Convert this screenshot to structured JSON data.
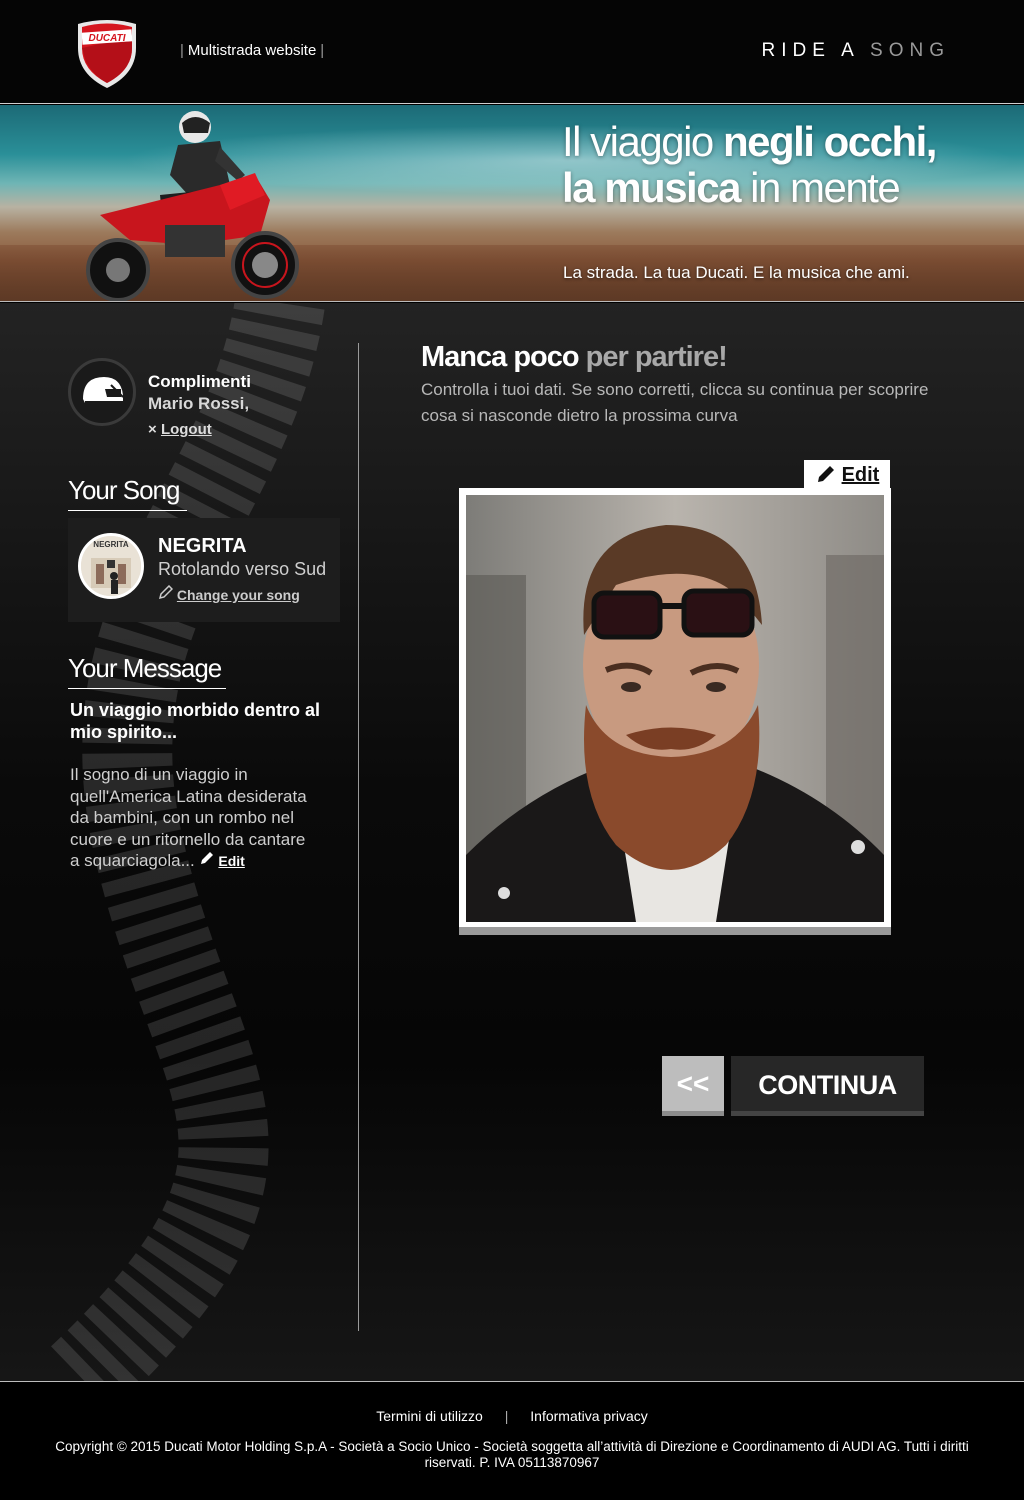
{
  "header": {
    "logo_text": "DUCATI",
    "site_link": "Multistrada website",
    "pipe": "|",
    "brand_ride": "RIDE A",
    "brand_song": "SONG"
  },
  "hero": {
    "title_light_1": "Il viaggio ",
    "title_bold_1": "negli occhi,",
    "title_bold_2": "la musica",
    "title_light_2": " in mente",
    "subtitle": "La strada. La tua Ducati. E la musica che ami."
  },
  "user": {
    "greeting": "Complimenti",
    "name": "Mario Rossi,",
    "logout_icon": "×",
    "logout_label": "Logout"
  },
  "song": {
    "section_title": "Your Song",
    "cover_text": "NEGRITA",
    "artist": "NEGRITA",
    "track": "Rotolando verso Sud",
    "change_label": "Change your song"
  },
  "message": {
    "section_title": "Your Message",
    "headline": "Un viaggio morbido dentro al mio spirito...",
    "body": "Il sogno di un viaggio in quell'America Latina desiderata da bambini, con un rombo nel cuore e un ritornello da cantare a squarciagola...",
    "edit_label": "Edit"
  },
  "content": {
    "title_bold": "Manca poco",
    "title_grey": " per partire!",
    "description": "Controlla i tuoi dati. Se sono corretti, clicca su continua per scoprire cosa si nasconde dietro la prossima curva",
    "photo_edit_label": "Edit"
  },
  "actions": {
    "back_label": "<<",
    "continue_label": "CONTINUA"
  },
  "footer": {
    "terms": "Termini di utilizzo",
    "separator": "|",
    "privacy": "Informativa privacy",
    "copyright": "Copyright © 2015 Ducati Motor Holding S.p.A - Società a Socio Unico - Società soggetta all’attività di Direzione e Coordinamento di AUDI AG. Tutti i diritti riservati. P. IVA 05113870967"
  },
  "colors": {
    "ducati_red": "#d5161f",
    "background": "#000000",
    "muted_text": "#a8a8a8"
  }
}
